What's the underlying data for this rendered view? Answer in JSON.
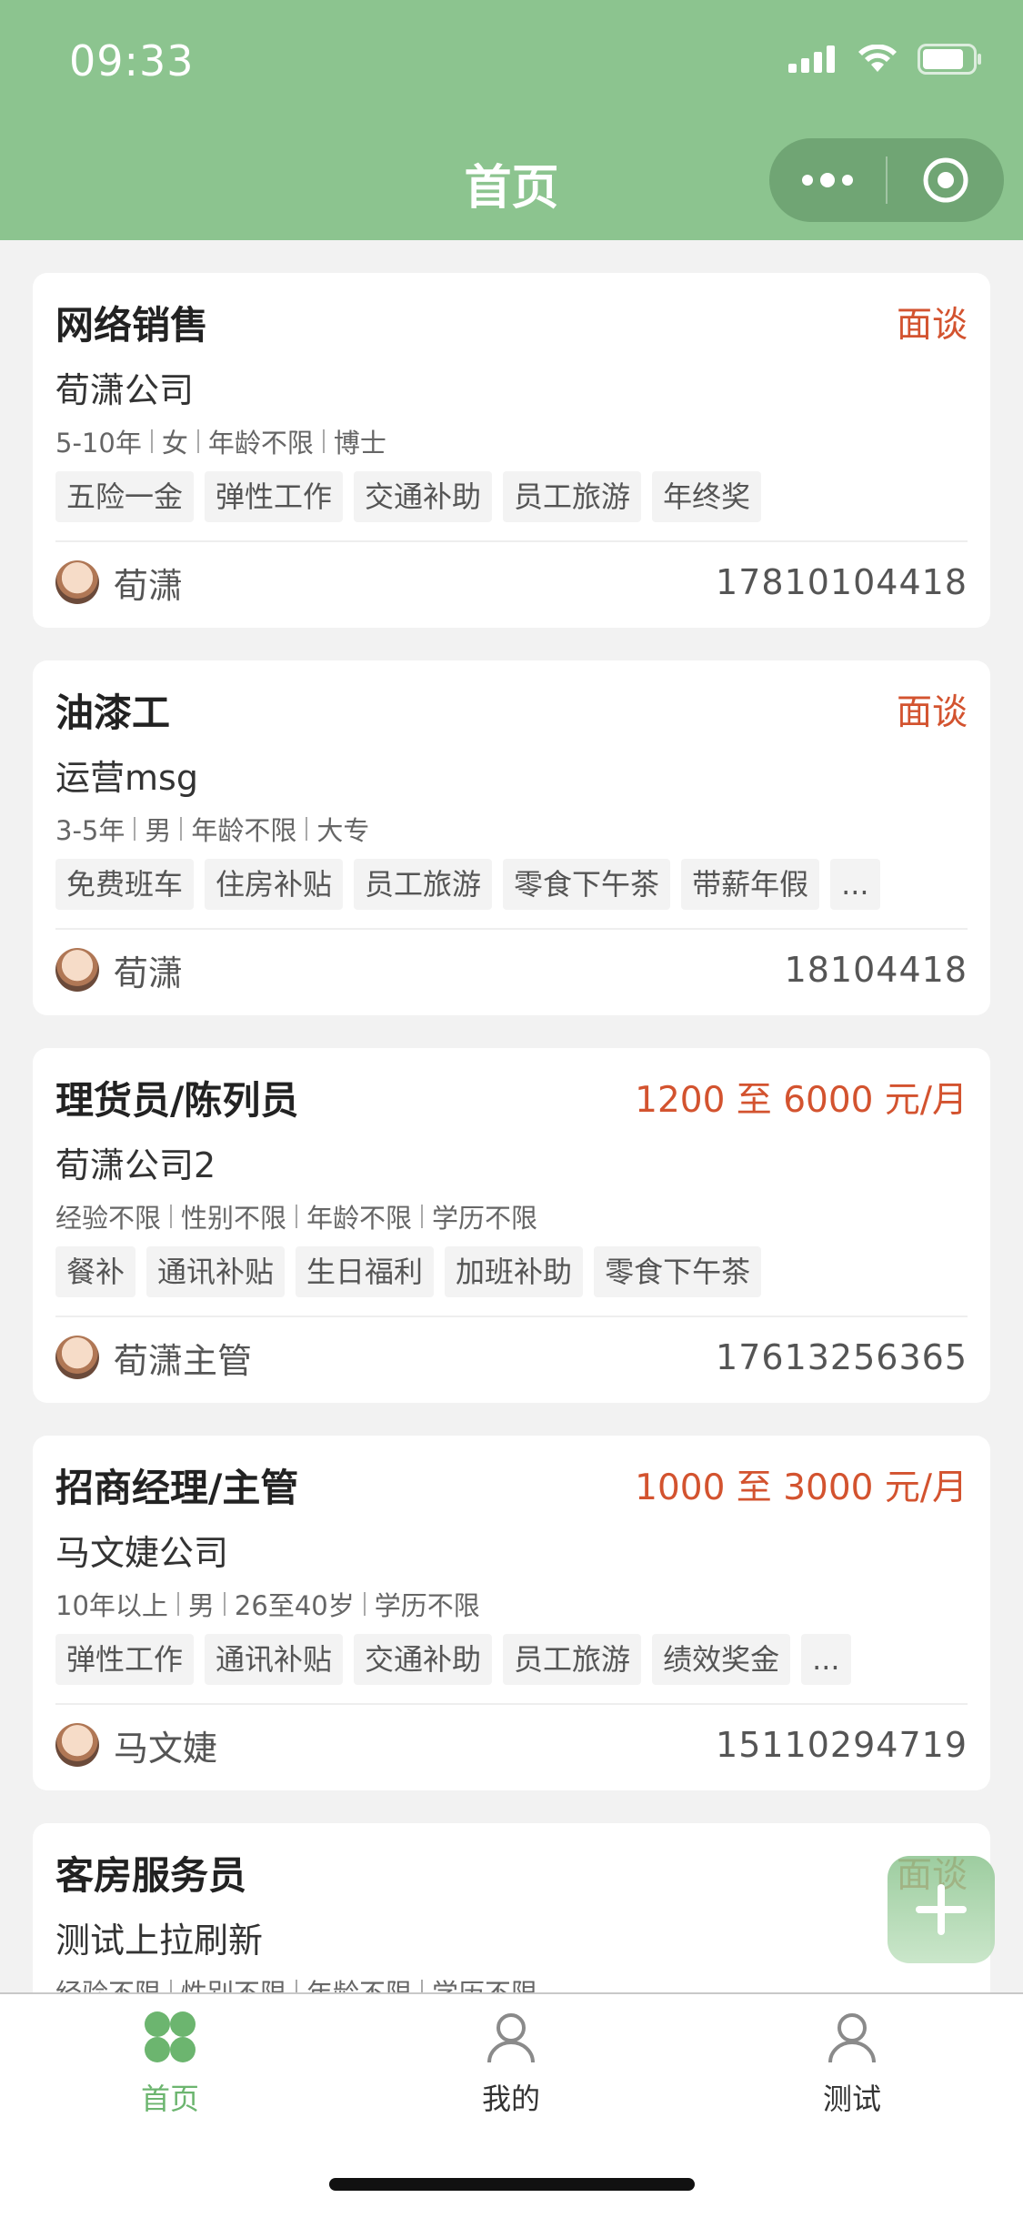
{
  "status_bar": {
    "time": "09:33"
  },
  "header": {
    "title": "首页",
    "more_icon": "more-dots-icon",
    "close_icon": "target-circle-icon",
    "background_color": "#8cc48f"
  },
  "jobs": [
    {
      "title": "网络销售",
      "salary": "面谈",
      "company": "荀潇公司",
      "requirements": [
        "5-10年",
        "女",
        "年龄不限",
        "博士"
      ],
      "tags": [
        "五险一金",
        "弹性工作",
        "交通补助",
        "员工旅游",
        "年终奖"
      ],
      "contact": "荀潇",
      "phone": "17810104418"
    },
    {
      "title": "油漆工",
      "salary": "面谈",
      "company": "运营msg",
      "requirements": [
        "3-5年",
        "男",
        "年龄不限",
        "大专"
      ],
      "tags": [
        "免费班车",
        "住房补贴",
        "员工旅游",
        "零食下午茶",
        "带薪年假",
        "..."
      ],
      "contact": "荀潇",
      "phone": "18104418"
    },
    {
      "title": "理货员/陈列员",
      "salary": "1200 至 6000 元/月",
      "company": "荀潇公司2",
      "requirements": [
        "经验不限",
        "性别不限",
        "年龄不限",
        "学历不限"
      ],
      "tags": [
        "餐补",
        "通讯补贴",
        "生日福利",
        "加班补助",
        "零食下午茶"
      ],
      "contact": "荀潇主管",
      "phone": "17613256365"
    },
    {
      "title": "招商经理/主管",
      "salary": "1000 至 3000 元/月",
      "company": "马文婕公司",
      "requirements": [
        "10年以上",
        "男",
        "26至40岁",
        "学历不限"
      ],
      "tags": [
        "弹性工作",
        "通讯补贴",
        "交通补助",
        "员工旅游",
        "绩效奖金",
        "..."
      ],
      "contact": "马文婕",
      "phone": "15110294719"
    },
    {
      "title": "客房服务员",
      "salary": "面谈",
      "company": "测试上拉刷新",
      "requirements": [
        "经验不限",
        "性别不限",
        "年龄不限",
        "学历不限"
      ]
    }
  ],
  "fab": {
    "icon": "plus-icon"
  },
  "tabbar": {
    "items": [
      {
        "label": "首页",
        "icon": "home-clover-icon",
        "active": true
      },
      {
        "label": "我的",
        "icon": "person-icon",
        "active": false
      },
      {
        "label": "测试",
        "icon": "person-icon",
        "active": false
      }
    ],
    "active_color": "#6cb56f"
  },
  "colors": {
    "salary": "#d3532f"
  }
}
